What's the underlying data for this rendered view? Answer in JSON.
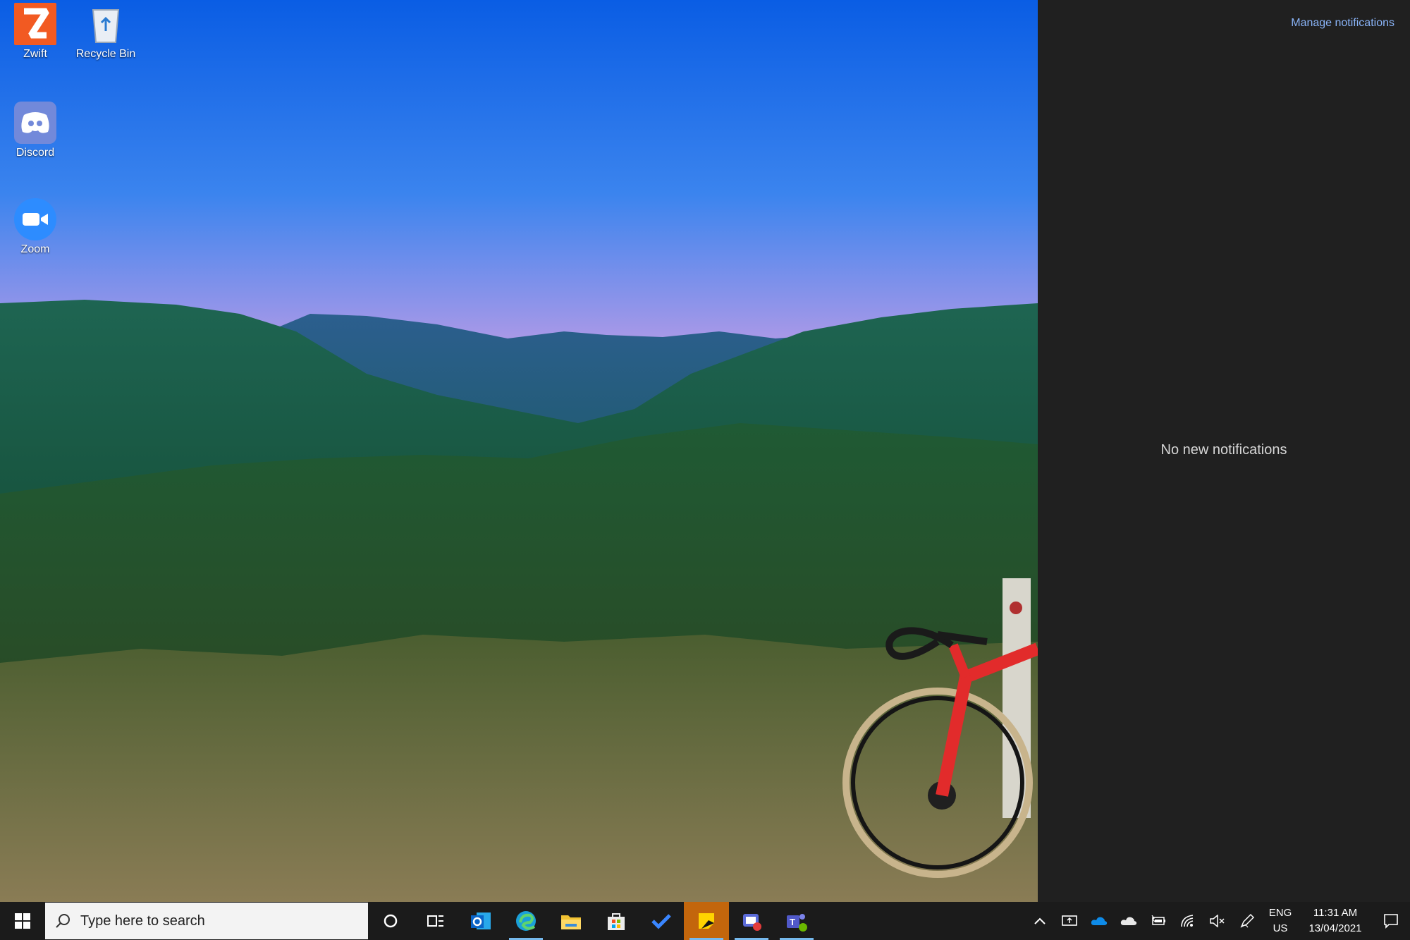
{
  "desktop": {
    "icons": [
      {
        "label": "Zwift"
      },
      {
        "label": "Recycle Bin"
      },
      {
        "label": "Discord"
      },
      {
        "label": "Zoom"
      }
    ]
  },
  "action_center": {
    "manage_link": "Manage notifications",
    "empty_message": "No new notifications"
  },
  "taskbar": {
    "search_placeholder": "Type here to search",
    "pinned": [
      "cortana-icon",
      "task-view-icon",
      "outlook-icon",
      "edge-icon",
      "file-explorer-icon",
      "store-icon",
      "todo-icon",
      "sticky-notes-icon",
      "app-icon",
      "teams-icon"
    ],
    "language_line1": "ENG",
    "language_line2": "US",
    "time": "11:31 AM",
    "date": "13/04/2021"
  },
  "colors": {
    "action_center_bg": "#202020",
    "taskbar_bg": "#1b1b1b",
    "link": "#8ab4f8",
    "active_app": "#c3660c"
  }
}
